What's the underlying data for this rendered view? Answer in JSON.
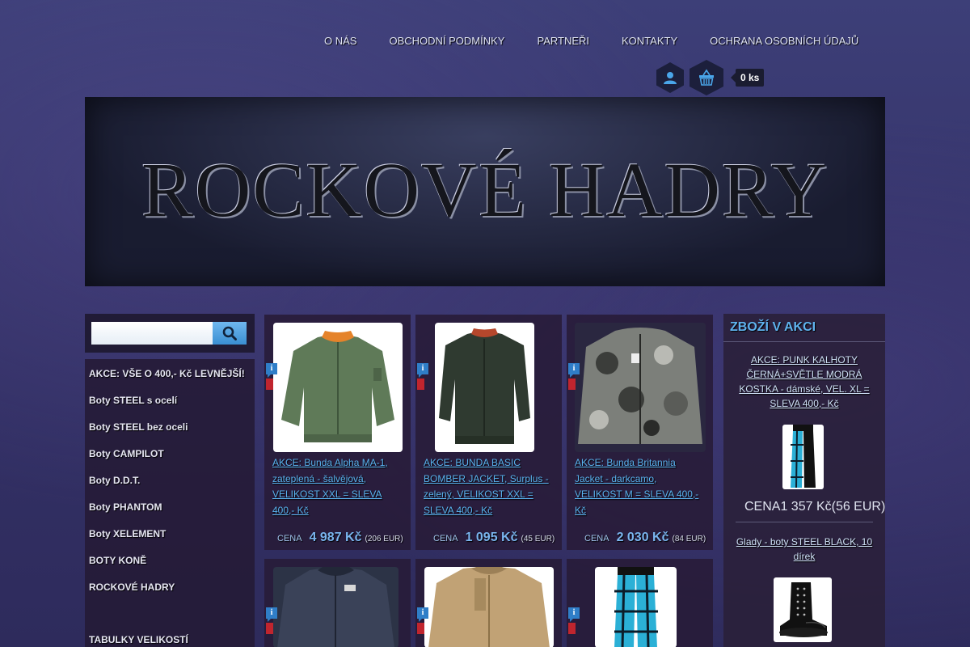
{
  "nav": {
    "items": [
      "O NÁS",
      "OBCHODNÍ PODMÍNKY",
      "PARTNEŘI",
      "KONTAKTY",
      "OCHRANA OSOBNÍCH ÚDAJŮ"
    ]
  },
  "cart": {
    "count": "0 ks"
  },
  "banner": {
    "title": "ROCKOVÉ HADRY"
  },
  "search": {
    "placeholder": ""
  },
  "sidebar": {
    "items": [
      "AKCE: VŠE O 400,- Kč LEVNĚJŠÍ!",
      "Boty STEEL s ocelí",
      "Boty STEEL bez oceli",
      "Boty CAMPILOT",
      "Boty D.D.T.",
      "Boty PHANTOM",
      "Boty XELEMENT",
      "BOTY KONĚ",
      "ROCKOVÉ HADRY",
      "TABULKY VELIKOSTÍ"
    ]
  },
  "products": [
    {
      "title": "AKCE: Bunda Alpha MA-1, zateplená - šalvějová, VELIKOST XXL = SLEVA 400,- Kč",
      "price_label": "CENA",
      "price": "4 987 Kč",
      "eur": "(206 EUR)"
    },
    {
      "title": "AKCE: BUNDA BASIC BOMBER JACKET, Surplus - zelený, VELIKOST XXL = SLEVA 400,- Kč",
      "price_label": "CENA",
      "price": "1 095 Kč",
      "eur": "(45 EUR)"
    },
    {
      "title": "AKCE: Bunda Britannia Jacket - darkcamo, VELIKOST M = SLEVA 400,- Kč",
      "price_label": "CENA",
      "price": "2 030 Kč",
      "eur": "(84 EUR)"
    }
  ],
  "promo": {
    "heading": "ZBOŽÍ V AKCI",
    "items": [
      {
        "title": "AKCE: PUNK KALHOTY ČERNÁ+SVĚTLE MODRÁ KOSTKA - dámské, VEL. XL = SLEVA 400,- Kč",
        "price_label": "CENA",
        "price": "1 357 Kč",
        "eur": "(56 EUR)"
      },
      {
        "title": "Glady - boty STEEL BLACK, 10 dírek"
      }
    ]
  },
  "colors": {
    "accent_blue": "#5ab3f0",
    "search_button": "#3a8fd3",
    "sale_flag": "#c0252e"
  },
  "icons": {
    "user": "user-icon",
    "cart": "basket-icon",
    "search": "magnifier-icon",
    "info": "info-icon"
  }
}
